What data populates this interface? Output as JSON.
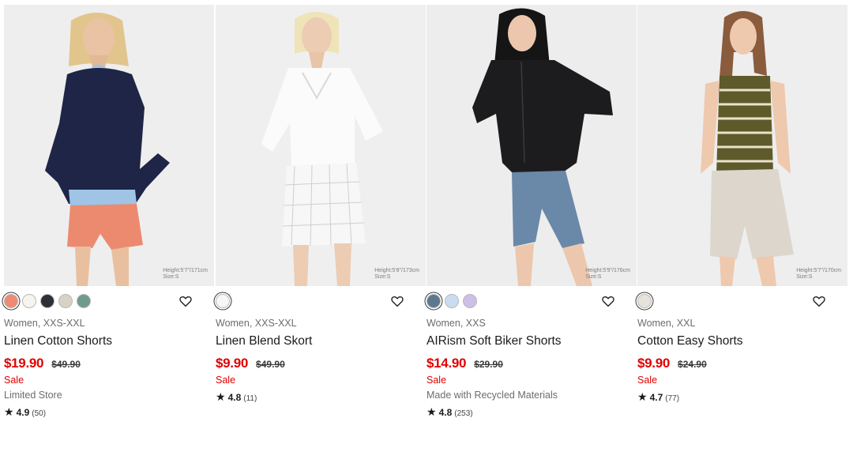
{
  "products": [
    {
      "photo_bg": "#eeeeee",
      "model_size": "Height:5'7\"/171cm\nSize:S",
      "swatches": [
        {
          "color": "#ef8a72",
          "selected": true
        },
        {
          "color": "#f6f4ee",
          "selected": false
        },
        {
          "color": "#2e3036",
          "selected": false
        },
        {
          "color": "#d7d2c5",
          "selected": false
        },
        {
          "color": "#6f9b8a",
          "selected": false
        }
      ],
      "meta": "Women, XXS-XXL",
      "name": "Linen Cotton Shorts",
      "price": "$19.90",
      "original_price": "$49.90",
      "sale_label": "Sale",
      "flag": "Limited Store",
      "rating": "4.9",
      "review_count": "(50)"
    },
    {
      "photo_bg": "#efefef",
      "model_size": "Height:5'8\"/173cm\nSize:S",
      "swatches": [
        {
          "color": "#f7f7f7",
          "selected": true
        }
      ],
      "meta": "Women, XXS-XXL",
      "name": "Linen Blend Skort",
      "price": "$9.90",
      "original_price": "$49.90",
      "sale_label": "Sale",
      "flag": "",
      "rating": "4.8",
      "review_count": "(11)"
    },
    {
      "photo_bg": "#ededed",
      "model_size": "Height:5'9\"/176cm\nSize:S",
      "swatches": [
        {
          "color": "#5f7892",
          "selected": true
        },
        {
          "color": "#c9dcf0",
          "selected": false
        },
        {
          "color": "#cdbfe6",
          "selected": false
        }
      ],
      "meta": "Women, XXS",
      "name": "AIRism Soft Biker Shorts",
      "price": "$14.90",
      "original_price": "$29.90",
      "sale_label": "Sale",
      "flag": "Made with Recycled Materials",
      "rating": "4.8",
      "review_count": "(253)"
    },
    {
      "photo_bg": "#eeeeee",
      "model_size": "Height:5'7\"/170cm\nSize:S",
      "swatches": [
        {
          "color": "#e5e3dc",
          "selected": true
        }
      ],
      "meta": "Women, XXL",
      "name": "Cotton Easy Shorts",
      "price": "$9.90",
      "original_price": "$24.90",
      "sale_label": "Sale",
      "flag": "",
      "rating": "4.7",
      "review_count": "(77)"
    }
  ],
  "icons": {
    "favorite": "heart-outline-icon",
    "rating": "star-icon"
  },
  "colors": {
    "sale": "#e00000",
    "text": "#1b1b1b",
    "muted": "#6c6c6c"
  }
}
